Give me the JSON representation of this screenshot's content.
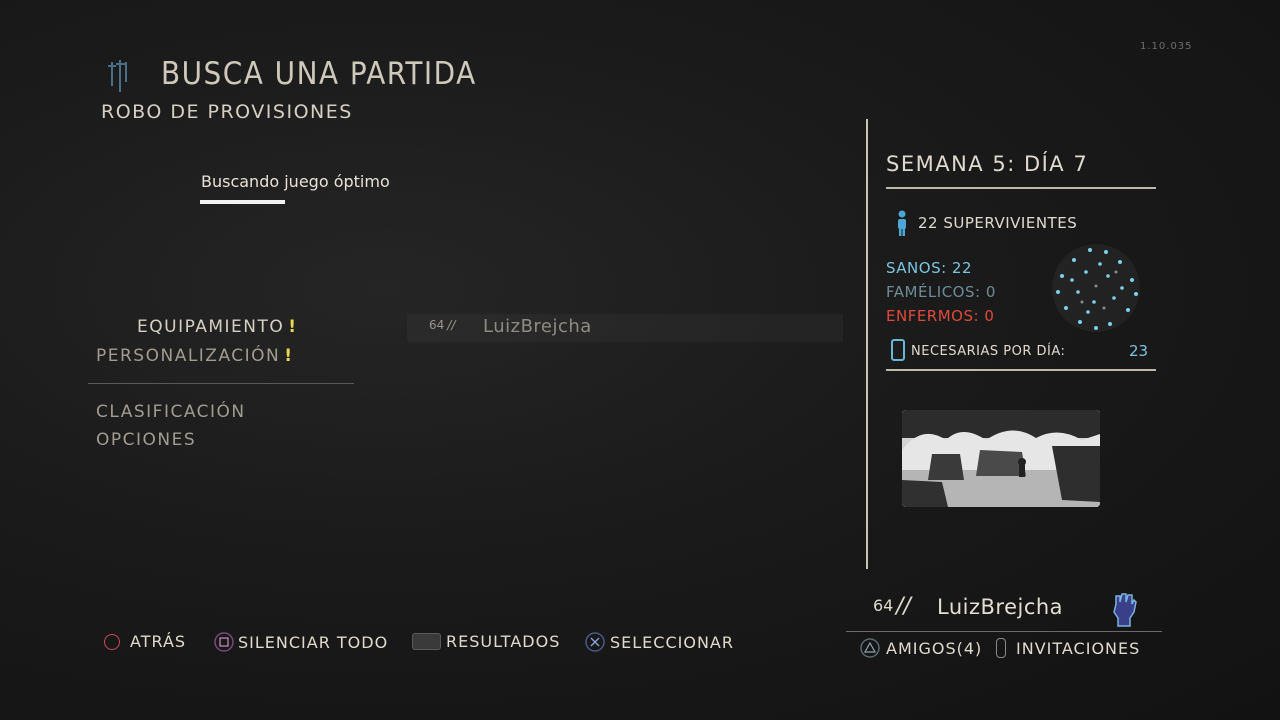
{
  "version": "1.10.035",
  "header": {
    "title": "BUSCA UNA PARTIDA",
    "subtitle": "ROBO DE PROVISIONES"
  },
  "search": {
    "status": "Buscando juego óptimo"
  },
  "menu": {
    "items": [
      {
        "label": "EQUIPAMIENTO",
        "warn": "!"
      },
      {
        "label": "PERSONALIZACIÓN",
        "warn": "!"
      },
      {
        "label": "CLASIFICACIÓN"
      },
      {
        "label": "OPCIONES"
      }
    ]
  },
  "lobby": {
    "players": [
      {
        "rank": "64",
        "name": "LuizBrejcha"
      }
    ]
  },
  "clan": {
    "week_label": "SEMANA 5: DÍA 7",
    "survivors": "22 SUPERVIVIENTES",
    "healthy": "SANOS: 22",
    "starving": "FAMÉLICOS: 0",
    "sick": "ENFERMOS: 0",
    "needed_label": "NECESARIAS POR DÍA:",
    "needed_value": "23",
    "colors": {
      "healthy": "#7cc4e0",
      "starving": "#6e8c98",
      "sick": "#e04a3a"
    }
  },
  "profile": {
    "rank": "64",
    "slash": "//",
    "name": "LuizBrejcha",
    "friends_label": "AMIGOS(4)",
    "invites_label": "INVITACIONES"
  },
  "footer": {
    "back": "ATRÁS",
    "mute": "SILENCIAR TODO",
    "results": "RESULTADOS",
    "select": "SELECCIONAR"
  }
}
